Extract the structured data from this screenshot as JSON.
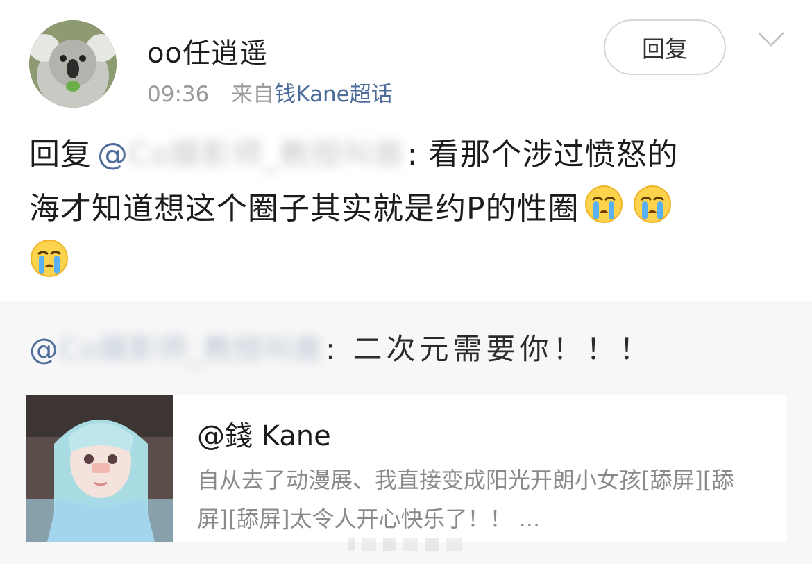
{
  "header": {
    "username": "oo任逍遥",
    "time": "09:36",
    "source_prefix": "来自",
    "source_link": "钱Kane超话",
    "reply_button_label": "回复",
    "menu_icon": "chevron-down-icon"
  },
  "comment": {
    "reply_prefix": "回复",
    "mention_at": "@",
    "mention_blurred": "Co摄影师_教授叫兽",
    "colon": ":",
    "text_line1": " 看那个涉过愤怒的",
    "text_line2": "海才知道想这个圈子其实就是约P的性圈",
    "emojis": [
      "crying-face-icon",
      "crying-face-icon",
      "crying-face-icon"
    ]
  },
  "quote": {
    "mention_at": "@",
    "mention_blurred": "Co摄影师_教授叫兽",
    "text": ": 二次元需要你！！！",
    "card": {
      "author": "@錢 Kane",
      "excerpt": "自从去了动漫展、我直接变成阳光开朗小女孩[舔屏][舔屏][舔屏]太令人开心快乐了！！ ..."
    }
  },
  "colors": {
    "link": "#4e6d9a",
    "text_primary": "#1c1c1c",
    "text_secondary": "#9a9a9a",
    "quote_background": "#f7f7f7"
  }
}
